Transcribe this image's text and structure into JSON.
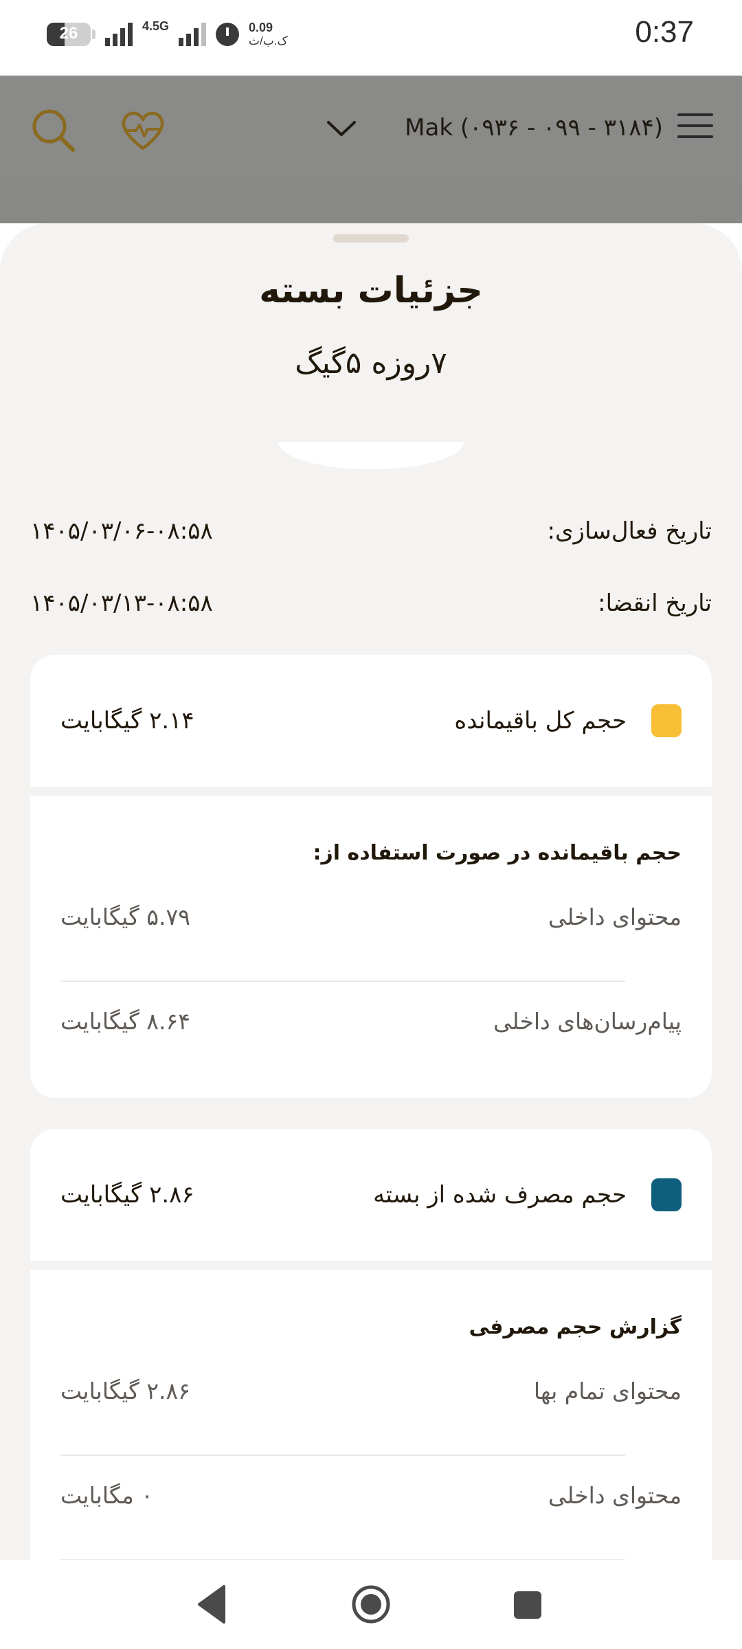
{
  "status_bar": {
    "battery": "26",
    "network": "4.5G",
    "speed_value": "0.09",
    "speed_unit": "ک.ب/ث",
    "time": "0:37"
  },
  "header": {
    "account": "Mak (۰۹۳۶ - ۰۹۹ - ۳۱۸۴)"
  },
  "sheet": {
    "title": "جزئیات بسته",
    "package_name": "۷روزه ۵گیگ",
    "activation": {
      "label": "تاریخ فعال‌سازی:",
      "value": "۱۴۰۵/۰۳/۰۶-۰۸:۵۸"
    },
    "expiry": {
      "label": "تاریخ انقضا:",
      "value": "۱۴۰۵/۰۳/۱۳-۰۸:۵۸"
    },
    "remaining": {
      "label": "حجم کل باقیمانده",
      "value": "۲.۱۴ گیگابایت",
      "color": "#F7BE36",
      "section_title": "حجم باقیمانده در صورت استفاده از:",
      "items": [
        {
          "label": "محتوای داخلی",
          "value": "۵.۷۹ گیگابایت"
        },
        {
          "label": "پیام‌رسان‌های داخلی",
          "value": "۸.۶۴ گیگابایت"
        }
      ]
    },
    "used": {
      "label": "حجم مصرف شده از بسته",
      "value": "۲.۸۶ گیگابایت",
      "color": "#0E5E7E",
      "section_title": "گزارش حجم مصرفی",
      "items": [
        {
          "label": "محتوای تمام بها",
          "value": "۲.۸۶ گیگابایت"
        },
        {
          "label": "محتوای داخلی",
          "value": "۰ مگابایت"
        }
      ]
    }
  }
}
